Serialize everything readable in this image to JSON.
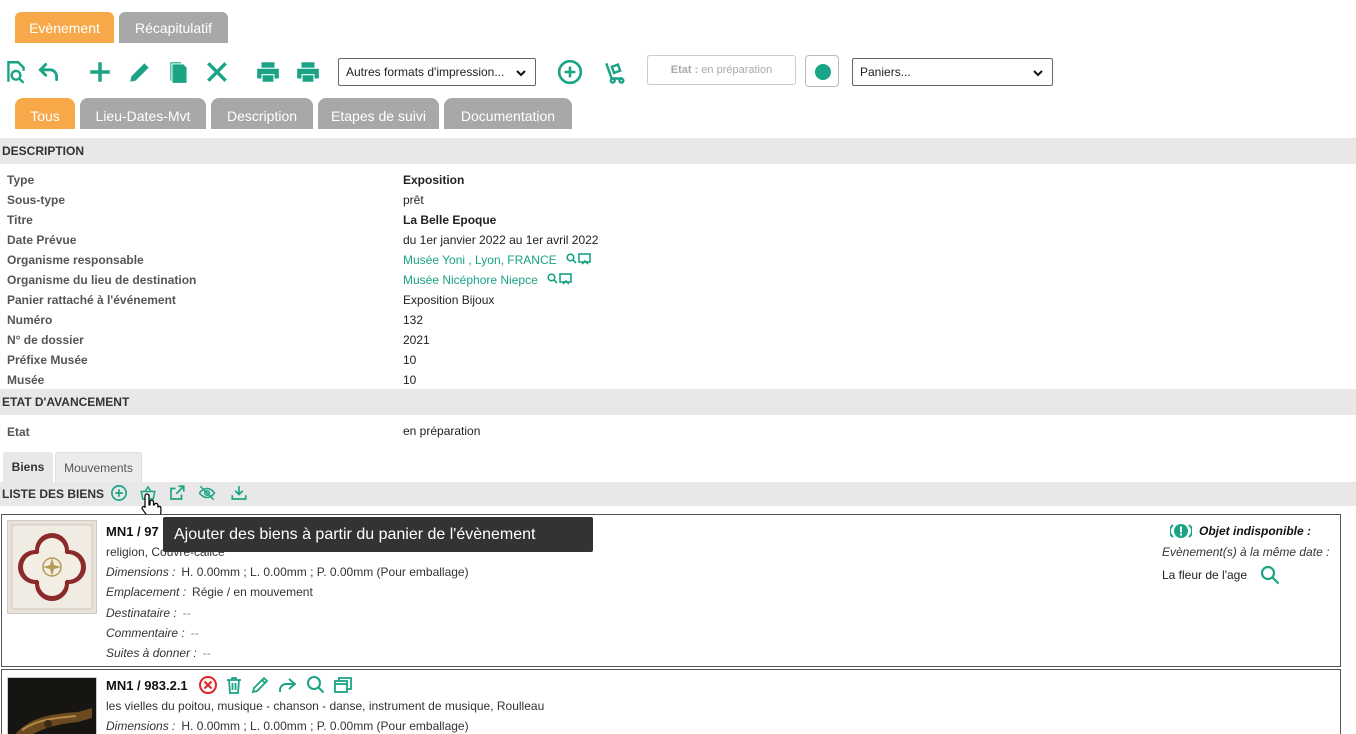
{
  "top_tabs": [
    {
      "label": "Evènement"
    },
    {
      "label": "Récapitulatif"
    }
  ],
  "toolbar": {
    "print_formats_label": "Autres formats d'impression...",
    "etat_label": "Etat :",
    "etat_value": "en préparation",
    "paniers_label": "Paniers...",
    "status_color": "#1aa384"
  },
  "sub_tabs": [
    {
      "label": "Tous"
    },
    {
      "label": "Lieu-Dates-Mvt"
    },
    {
      "label": "Description"
    },
    {
      "label": "Etapes de suivi"
    },
    {
      "label": "Documentation"
    }
  ],
  "description": {
    "title": "DESCRIPTION",
    "rows": [
      {
        "label": "Type",
        "value": "Exposition"
      },
      {
        "label": "Sous-type",
        "value": "prêt"
      },
      {
        "label": "Titre",
        "value": "La Belle Epoque"
      },
      {
        "label": "Date Prévue",
        "value": "du 1er janvier 2022 au 1er avril 2022"
      },
      {
        "label": "Organisme responsable",
        "value": "Musée Yoni , Lyon, FRANCE"
      },
      {
        "label": "Organisme du lieu de destination",
        "value": "Musée Nicéphore Niepce"
      },
      {
        "label": "Panier rattaché à l'événement",
        "value": "Exposition Bijoux"
      },
      {
        "label": "Numéro",
        "value": "132"
      },
      {
        "label": "N° de dossier",
        "value": "2021"
      },
      {
        "label": "Préfixe Musée",
        "value": "10"
      },
      {
        "label": "Musée",
        "value": "10"
      }
    ]
  },
  "avancement": {
    "title": "ETAT D'AVANCEMENT",
    "label": "Etat",
    "value": "en préparation"
  },
  "bottom_tabs": [
    {
      "label": "Biens"
    },
    {
      "label": "Mouvements"
    }
  ],
  "liste": {
    "title": "LISTE DES BIENS",
    "tooltip": "Ajouter des biens à partir du panier de l'évènement"
  },
  "items": [
    {
      "title": "MN1 / 97",
      "subtitle": "religion, Couvre-calice",
      "dimensions_label": "Dimensions :",
      "dimensions": "H. 0.00mm ; L. 0.00mm ; P. 0.00mm (Pour emballage)",
      "emplacement_label": "Emplacement :",
      "emplacement": "Régie / en mouvement",
      "destinataire_label": "Destinataire :",
      "destinataire": "--",
      "commentaire_label": "Commentaire :",
      "commentaire": "--",
      "suites_label": "Suites à donner :",
      "suites": "--",
      "indispo_label": "Objet indisponible :",
      "meme_date_label": "Evènement(s) à la même date :",
      "meme_date_value": "La fleur de l'age"
    },
    {
      "title": "MN1 / 983.2.1",
      "subtitle": "les vielles du poitou, musique - chanson - danse, instrument de musique, Roulleau",
      "dimensions_label": "Dimensions :",
      "dimensions": "H. 0.00mm ; L. 0.00mm ; P. 0.00mm (Pour emballage)"
    }
  ]
}
